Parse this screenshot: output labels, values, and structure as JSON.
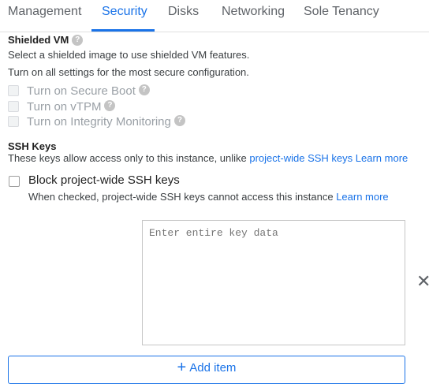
{
  "tabs": [
    {
      "label": "Management"
    },
    {
      "label": "Security"
    },
    {
      "label": "Disks"
    },
    {
      "label": "Networking"
    },
    {
      "label": "Sole Tenancy"
    }
  ],
  "active_tab": "Security",
  "shielded_vm": {
    "title": "Shielded VM",
    "description": "Select a shielded image to use shielded VM features.",
    "hint": "Turn on all settings for the most secure configuration.",
    "options": [
      {
        "label": "Turn on Secure Boot",
        "has_help": true
      },
      {
        "label": "Turn on vTPM",
        "has_help": true
      },
      {
        "label": "Turn on Integrity Monitoring",
        "has_help": true
      }
    ]
  },
  "ssh_keys": {
    "title": "SSH Keys",
    "description": "These keys allow access only to this instance, unlike ",
    "project_wide_link": "project-wide SSH keys",
    "learn_more_link": "Learn more",
    "block_label": "Block project-wide SSH keys",
    "block_description": "When checked, project-wide SSH keys cannot access this instance ",
    "block_learn_more": "Learn more",
    "key_placeholder": "Enter entire key data",
    "remove_glyph": "✕",
    "add_item_label": "Add item",
    "add_item_glyph": "+"
  },
  "colors": {
    "accent": "#1a73e8",
    "text": "#212121",
    "muted": "#9aa0a6"
  }
}
